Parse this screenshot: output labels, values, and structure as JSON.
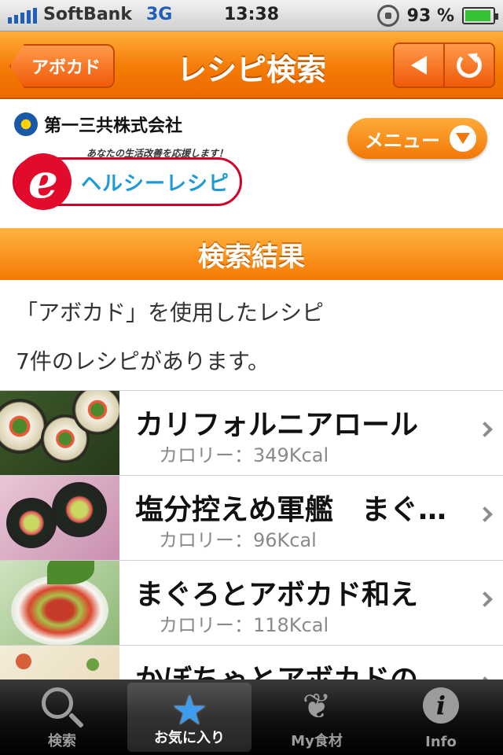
{
  "status_bar": {
    "carrier": "SoftBank",
    "network": "3G",
    "time": "13:38",
    "battery_pct": "93 %",
    "battery_level": 0.93
  },
  "nav": {
    "back_label": "アボカド",
    "title": "レシピ検索"
  },
  "brand": {
    "company": "第一三共株式会社",
    "tagline": "あなたの生活改善を応援します！",
    "logo_text": "ヘルシーレシピ",
    "menu_label": "メニュー"
  },
  "results": {
    "header": "検索結果",
    "query_line": "「アボカド」を使用したレシピ",
    "count_line": "7件のレシピがあります。",
    "items": [
      {
        "title": "カリフォルニアロール",
        "calories": "カロリー：349Kcal"
      },
      {
        "title": "塩分控えめ軍艦　まぐ…",
        "calories": "カロリー：96Kcal"
      },
      {
        "title": "まぐろとアボカド和え",
        "calories": "カロリー：118Kcal"
      },
      {
        "title": "かぼちゃとアボカドの…",
        "calories": ""
      }
    ]
  },
  "tabs": [
    {
      "label": "検索",
      "icon": "search-icon"
    },
    {
      "label": "お気に入り",
      "icon": "star-icon"
    },
    {
      "label": "My食材",
      "icon": "vegetable-icon"
    },
    {
      "label": "Info",
      "icon": "info-icon"
    }
  ],
  "colors": {
    "accent_orange": "#f47a06",
    "tab_active_star": "#3d9cf0",
    "logo_red": "#e30b2b",
    "logo_blue": "#1e9bd7"
  }
}
